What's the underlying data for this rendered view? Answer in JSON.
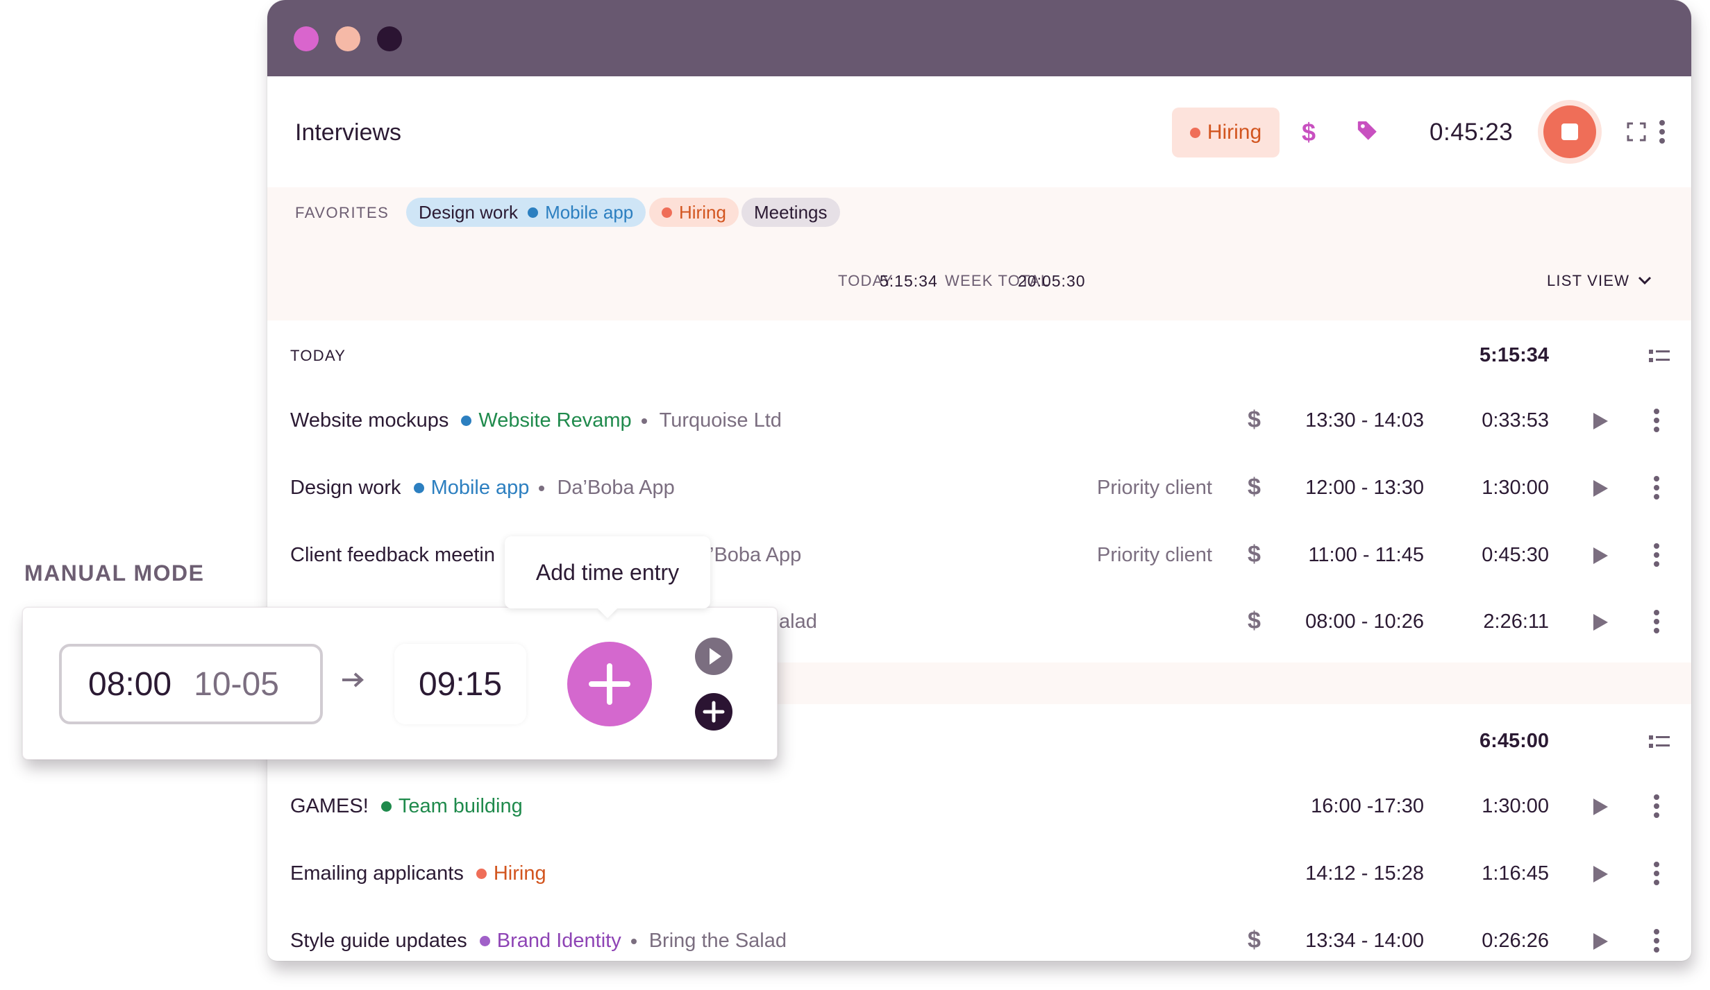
{
  "header": {
    "title": "Interviews",
    "active_tag": "Hiring",
    "billable_icon": "$",
    "timer": "0:45:23"
  },
  "favorites": {
    "label": "FAVORITES",
    "design_work": "Design work",
    "mobile_app": "Mobile app",
    "hiring": "Hiring",
    "meetings": "Meetings"
  },
  "summary": {
    "today_label": "TODAY",
    "today_value": "5:15:34",
    "week_label": "WEEK TOTAL",
    "week_value": "20:05:30",
    "view_label": "LIST VIEW"
  },
  "groups": [
    {
      "label": "TODAY",
      "total": "5:15:34"
    },
    {
      "label": "",
      "total": "6:45:00"
    }
  ],
  "entries": [
    {
      "description": "Website mockups",
      "project": "Website Revamp",
      "project_color": "#1f8a4c",
      "client": "Turquoise Ltd",
      "tag": "",
      "billable": "$",
      "range": "13:30 - 14:03",
      "duration": "0:33:53"
    },
    {
      "description": "Design work",
      "project": "Mobile app",
      "project_color": "#2c7fc0",
      "client": "Da’Boba App",
      "tag": "Priority client",
      "billable": "$",
      "range": "12:00 - 13:30",
      "duration": "1:30:00"
    },
    {
      "description": "Client feedback meetin",
      "client_fragment": "’Boba App",
      "tag": "Priority client",
      "billable": "$",
      "range": "11:00 - 11:45",
      "duration": "0:45:30"
    },
    {
      "fragment": "alad",
      "billable": "$",
      "range": "08:00 - 10:26",
      "duration": "2:26:11"
    },
    {
      "description": "GAMES!",
      "project": "Team building",
      "project_color": "#1f8a4c",
      "range": "16:00 -17:30",
      "duration": "1:30:00"
    },
    {
      "description": "Emailing applicants",
      "project": "Hiring",
      "project_color": "#d2551f",
      "range": "14:12 - 15:28",
      "duration": "1:16:45"
    },
    {
      "description": "Style guide updates",
      "project": "Brand Identity",
      "project_color": "#8e44b5",
      "client": "Bring the Salad",
      "billable": "$",
      "range": "13:34 - 14:00",
      "duration": "0:26:26"
    }
  ],
  "manual": {
    "label": "MANUAL MODE",
    "start_time": "08:00",
    "start_date": "10-05",
    "end_time": "09:15",
    "tooltip": "Add time entry"
  },
  "colors": {
    "titlebar": "#685870",
    "accent_pink": "#d468ce",
    "stop_red": "#ef6e58",
    "hiring_orange": "#d2551f"
  },
  "icons": [
    "dollar-icon",
    "tag-icon",
    "stop-icon",
    "expand-icon",
    "kebab-icon",
    "chevron-down-icon",
    "list-icon",
    "play-icon",
    "plus-icon",
    "arrow-right-icon"
  ]
}
